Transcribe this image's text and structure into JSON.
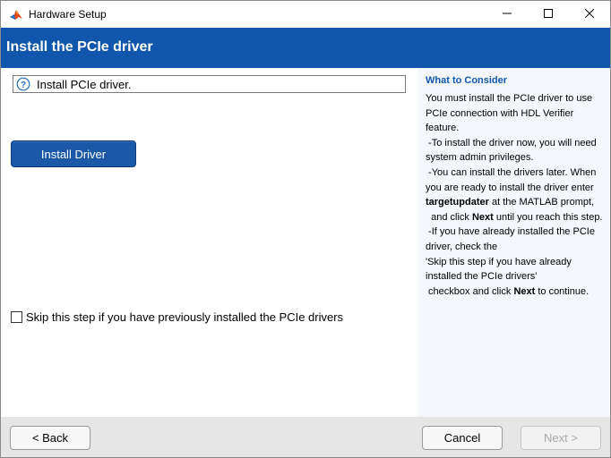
{
  "window": {
    "title": "Hardware Setup",
    "icon": "matlab-logo-icon",
    "controls": [
      "minimize-icon",
      "maximize-icon",
      "close-icon"
    ]
  },
  "header": {
    "title": "Install the PCIe driver",
    "background_color": "#0f56ac"
  },
  "main": {
    "info": {
      "icon": "help-icon",
      "text": "Install PCIe driver."
    },
    "install_button_label": "Install Driver",
    "skip_checkbox": {
      "label": "Skip this step if you have previously installed the PCIe drivers",
      "checked": false
    }
  },
  "side": {
    "heading": "What to Consider",
    "lines": [
      [
        {
          "t": "You must install the PCIe driver to use"
        }
      ],
      [
        {
          "t": "PCIe connection with HDL Verifier"
        }
      ],
      [
        {
          "t": "feature."
        }
      ],
      [
        {
          "t": " -To install the driver now, you will need"
        }
      ],
      [
        {
          "t": "system admin privileges."
        }
      ],
      [
        {
          "t": " -You can install the drivers later. When"
        }
      ],
      [
        {
          "t": "you are ready to install the driver enter"
        }
      ],
      [
        {
          "t": "targetupdater",
          "b": true
        },
        {
          "t": " at the MATLAB prompt,"
        }
      ],
      [
        {
          "t": "  and click "
        },
        {
          "t": "Next",
          "b": true
        },
        {
          "t": " until you reach this step."
        }
      ],
      [
        {
          "t": " -If you have already installed the PCIe"
        }
      ],
      [
        {
          "t": "driver, check the"
        }
      ],
      [
        {
          "t": "'Skip this step if you have already"
        }
      ],
      [
        {
          "t": "installed the PCIe drivers'"
        }
      ],
      [
        {
          "t": " checkbox and click "
        },
        {
          "t": "Next",
          "b": true
        },
        {
          "t": " to continue."
        }
      ]
    ]
  },
  "footer": {
    "back_label": "< Back",
    "cancel_label": "Cancel",
    "next_label": "Next >",
    "next_enabled": false
  }
}
